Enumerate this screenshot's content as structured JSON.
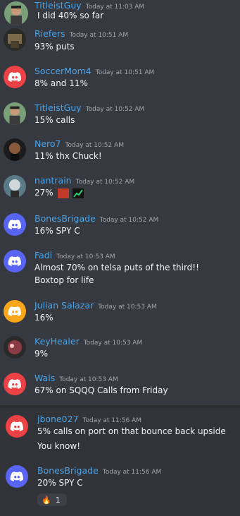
{
  "messages_top": [
    {
      "user": "TitleistGuy",
      "time": "Today at 11:03 AM",
      "lines": [
        "I did 40% so far"
      ]
    },
    {
      "user": "Riefers",
      "time": "Today at 10:51 AM",
      "lines": [
        "93% puts"
      ]
    },
    {
      "user": "SoccerMom4",
      "time": "Today at 10:51 AM",
      "lines": [
        "8% and 11%"
      ]
    },
    {
      "user": "TitleistGuy",
      "time": "Today at 10:52 AM",
      "lines": [
        "15% calls"
      ]
    },
    {
      "user": "Nero7",
      "time": "Today at 10:52 AM",
      "lines": [
        "11% thx Chuck!"
      ]
    },
    {
      "user": "nantrain",
      "time": "Today at 10:52 AM",
      "lines": [
        "27%"
      ]
    },
    {
      "user": "BonesBrigade",
      "time": "Today at 10:52 AM",
      "lines": [
        "16% SPY C"
      ]
    },
    {
      "user": "Fadi",
      "time": "Today at 10:53 AM",
      "lines": [
        "Almost 70% on telsa puts of the third!!",
        "Boxtop for life"
      ]
    },
    {
      "user": "Julian Salazar",
      "time": "Today at 10:53 AM",
      "lines": [
        "16%"
      ]
    },
    {
      "user": "KeyHealer",
      "time": "Today at 10:53 AM",
      "lines": [
        "9%"
      ]
    },
    {
      "user": "Wals",
      "time": "Today at 10:53 AM",
      "lines": [
        "67% on SQQQ Calls from Friday"
      ]
    }
  ],
  "messages_bottom": [
    {
      "user": "jbone027",
      "time": "Today at 11:56 AM",
      "lines": [
        "5% calls on port on that bounce back upside",
        "You know!"
      ]
    },
    {
      "user": "BonesBrigade",
      "time": "Today at 11:56 AM",
      "lines": [
        "20% SPY C"
      ],
      "reaction": {
        "emoji": "🔥",
        "count": "1"
      }
    }
  ],
  "colors": {
    "background": "#36393f",
    "username": "#4aa3e8",
    "discord_red": "#ed4245",
    "discord_blue": "#5865f2",
    "discord_orange": "#faa61a"
  }
}
